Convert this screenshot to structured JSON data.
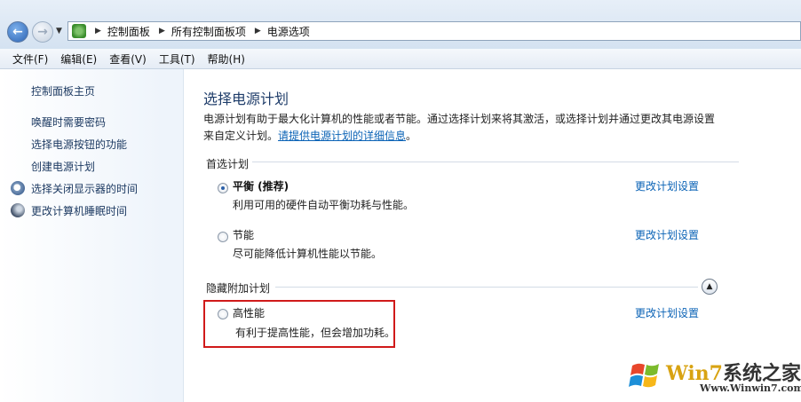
{
  "address": {
    "breadcrumbs": [
      "控制面板",
      "所有控制面板项",
      "电源选项"
    ]
  },
  "menu": [
    "文件(F)",
    "编辑(E)",
    "查看(V)",
    "工具(T)",
    "帮助(H)"
  ],
  "sidebar": {
    "home": "控制面板主页",
    "links": [
      "唤醒时需要密码",
      "选择电源按钮的功能",
      "创建电源计划",
      "选择关闭显示器的时间",
      "更改计算机睡眠时间"
    ]
  },
  "main": {
    "title": "选择电源计划",
    "intro": "电源计划有助于最大化计算机的性能或者节能。通过选择计划来将其激活，或选择计划并通过更改其电源设置来自定义计划。",
    "intro_link": "请提供电源计划的详细信息",
    "intro_end": "。",
    "preferred_label": "首选计划",
    "hidden_label": "隐藏附加计划",
    "change_link": "更改计划设置",
    "plans": [
      {
        "name": "平衡 (推荐)",
        "desc": "利用可用的硬件自动平衡功耗与性能。",
        "selected": true
      },
      {
        "name": "节能",
        "desc": "尽可能降低计算机性能以节能。",
        "selected": false
      },
      {
        "name": "高性能",
        "desc": "有利于提高性能，但会增加功耗。",
        "selected": false
      }
    ]
  },
  "watermark": {
    "title_part1": "Win7",
    "title_part2": "系统之家",
    "url": "Www.Winwin7.com"
  },
  "colors": {
    "link": "#0b63b6",
    "title": "#1f3d6a",
    "highlight": "#d01a1a"
  }
}
